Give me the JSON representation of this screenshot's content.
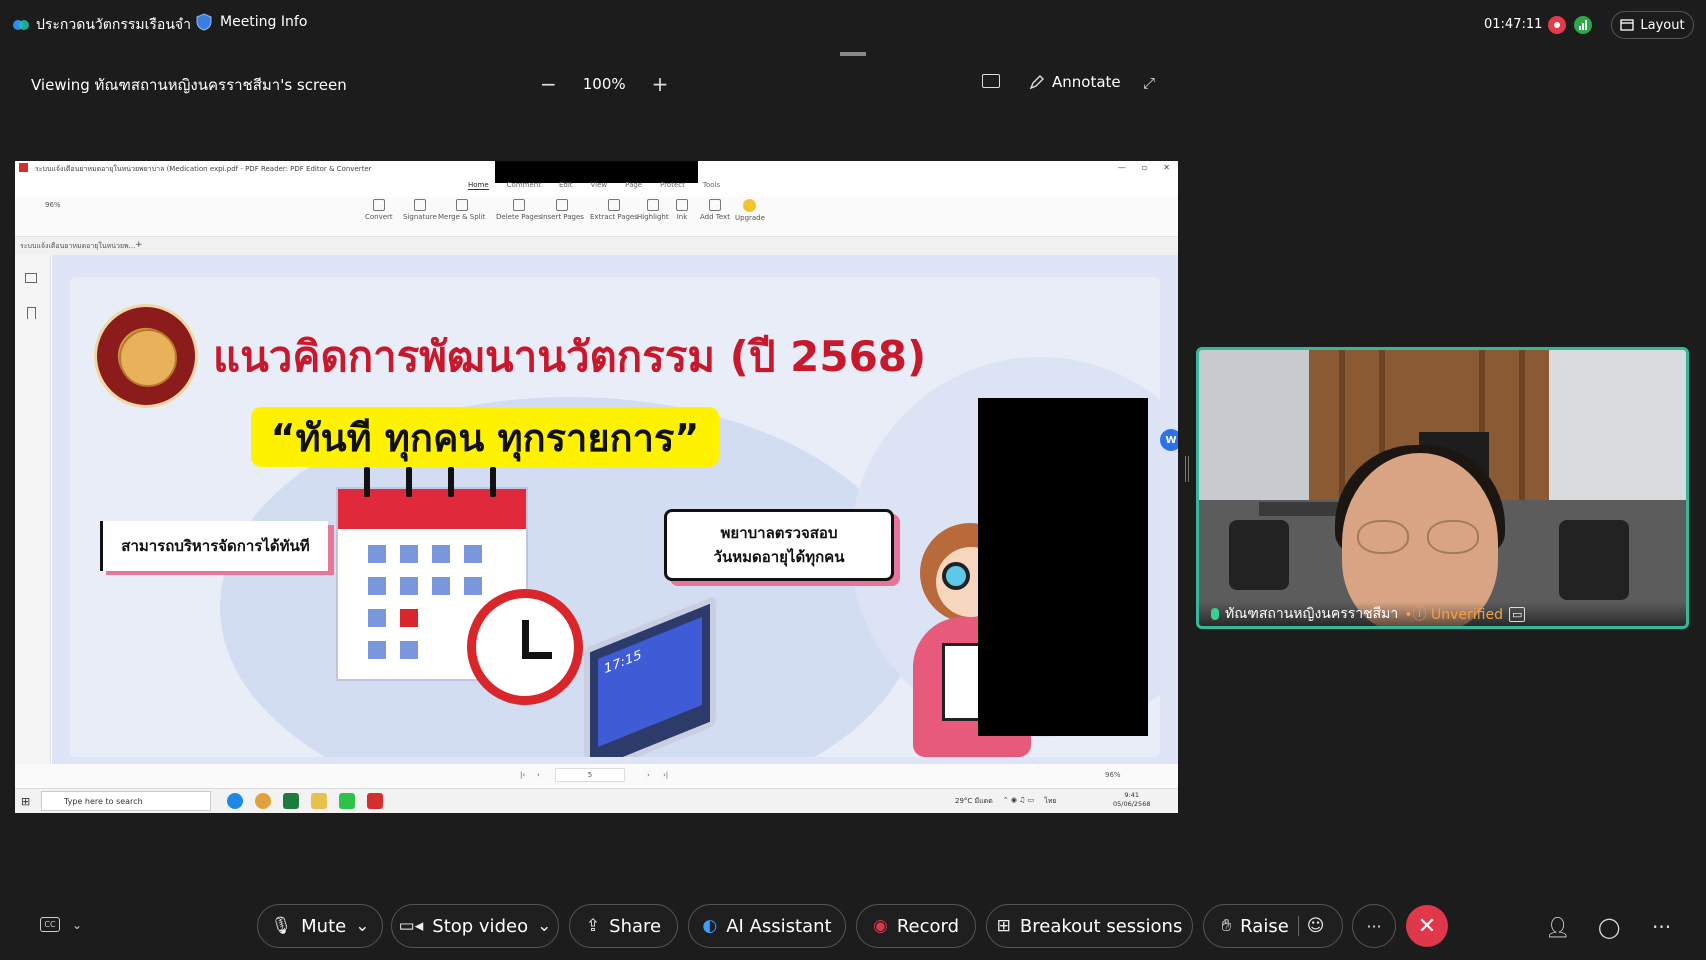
{
  "app": {
    "meeting_title": "ประกวดนวัตกรรมเรือนจำ",
    "meeting_info_label": "Meeting Info",
    "clock": "01:47:11",
    "layout_label": "Layout"
  },
  "share_bar": {
    "viewing_text": "Viewing ทัณฑสถานหญิงนครราชสีมา's screen",
    "zoom_level": "100%",
    "zoom_out": "−",
    "zoom_in": "+",
    "annotate_label": "Annotate"
  },
  "pdf_reader": {
    "window_title": "ระบบแจ้งเตือนยาหมดอายุในหน่วยพยาบาล (Medication expi.pdf - PDF Reader: PDF Editor & Converter",
    "menu_tabs": [
      "Home",
      "Comment",
      "Edit",
      "View",
      "Page",
      "Protect",
      "Tools"
    ],
    "zoom_value": "96%",
    "tools": [
      "Convert",
      "Signature",
      "Merge & Split",
      "Delete Pages",
      "Insert Pages",
      "Extract Pages",
      "Highlight",
      "Ink",
      "Add Text",
      "Upgrade"
    ],
    "doc_tab": "ระบบแจ้งเตือนยาหมดอายุในหน่วยพ...",
    "page_number": "5",
    "status_zoom": "96%",
    "avatar_letter": "W"
  },
  "slide": {
    "headline": "แนวคิดการพัฒนานวัตกรรม (ปี 2568)",
    "banner": "“ทันที ทุกคน ทุกรายการ”",
    "box_left": "สามารถบริหารจัดการได้ทันที",
    "box_right_line1": "พยาบาลตรวจสอบ",
    "box_right_line2": "วันหมดอายุได้ทุกคน",
    "monitor_time": "17:15"
  },
  "taskbar": {
    "search_placeholder": "Type here to search",
    "weather": "29°C มีแดด",
    "time": "9:41",
    "date": "05/06/2568",
    "lang": "ไทย"
  },
  "video": {
    "participant_name": "ทัณฑสถานหญิงนครราชสีมา",
    "status": "Unverified"
  },
  "controls": {
    "mute": "Mute",
    "stop_video": "Stop video",
    "share": "Share",
    "ai_assistant": "AI Assistant",
    "record": "Record",
    "breakout": "Breakout sessions",
    "raise": "Raise",
    "more": "···",
    "end": "✕"
  },
  "colors": {
    "accent_green": "#33b89a",
    "end_red": "#e0374a",
    "headline_red": "#c8182c",
    "banner_yellow": "#fff200",
    "unverified_orange": "#f2a340"
  }
}
